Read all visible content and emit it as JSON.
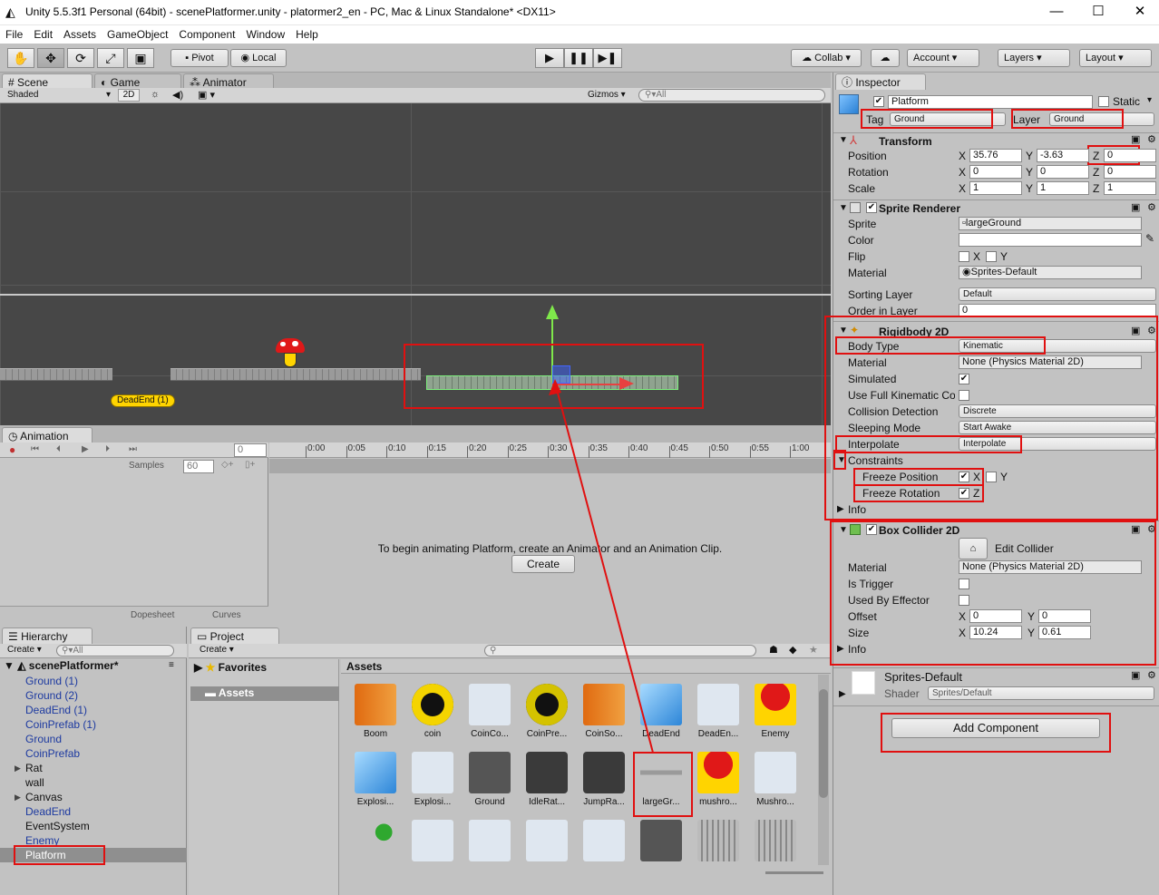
{
  "window": {
    "title": "Unity 5.5.3f1 Personal (64bit) - scenePlatformer.unity - platormer2_en - PC, Mac & Linux Standalone* <DX11>"
  },
  "menu": [
    "File",
    "Edit",
    "Assets",
    "GameObject",
    "Component",
    "Window",
    "Help"
  ],
  "toolbar": {
    "pivot": "Pivot",
    "local": "Local",
    "collab": "Collab",
    "account": "Account",
    "layers": "Layers",
    "layout": "Layout"
  },
  "scene": {
    "tabs": [
      "Scene",
      "Game",
      "Animator"
    ],
    "shading": "Shaded",
    "mode2d": "2D",
    "gizmos": "Gizmos",
    "search_placeholder": "All",
    "deadend_label": "DeadEnd (1)"
  },
  "animation": {
    "tab": "Animation",
    "frame": "0",
    "samples_label": "Samples",
    "samples": "60",
    "ticks": [
      "0:00",
      "0:05",
      "0:10",
      "0:15",
      "0:20",
      "0:25",
      "0:30",
      "0:35",
      "0:40",
      "0:45",
      "0:50",
      "0:55",
      "1:00"
    ],
    "message": "To begin animating Platform, create an Animator and an Animation Clip.",
    "create": "Create",
    "dopesheet": "Dopesheet",
    "curves": "Curves"
  },
  "hierarchy": {
    "tab": "Hierarchy",
    "create": "Create",
    "search_placeholder": "All",
    "scene": "scenePlatformer*",
    "items": [
      {
        "label": "Ground (1)",
        "color": "#1d3aa0",
        "arrow": ""
      },
      {
        "label": "Ground (2)",
        "color": "#1d3aa0",
        "arrow": ""
      },
      {
        "label": "DeadEnd (1)",
        "color": "#1d3aa0",
        "arrow": ""
      },
      {
        "label": "CoinPrefab (1)",
        "color": "#1d3aa0",
        "arrow": ""
      },
      {
        "label": "Ground",
        "color": "#1d3aa0",
        "arrow": ""
      },
      {
        "label": "CoinPrefab",
        "color": "#1d3aa0",
        "arrow": ""
      },
      {
        "label": "Rat",
        "color": "#111111",
        "arrow": "▶"
      },
      {
        "label": "wall",
        "color": "#111111",
        "arrow": ""
      },
      {
        "label": "Canvas",
        "color": "#111111",
        "arrow": "▶"
      },
      {
        "label": "DeadEnd",
        "color": "#1d3aa0",
        "arrow": ""
      },
      {
        "label": "EventSystem",
        "color": "#111111",
        "arrow": ""
      },
      {
        "label": "Enemy",
        "color": "#1d3aa0",
        "arrow": ""
      },
      {
        "label": "Platform",
        "color": "#1d3aa0",
        "arrow": ""
      }
    ]
  },
  "project": {
    "tab": "Project",
    "create": "Create",
    "favorites": "Favorites",
    "assets_folder": "Assets",
    "assets_header": "Assets",
    "assets_row1": [
      "Boom",
      "coin",
      "CoinCo...",
      "CoinPre...",
      "CoinSo...",
      "DeadEnd",
      "DeadEn...",
      "Enemy"
    ],
    "assets_row2": [
      "Explosi...",
      "Explosi...",
      "Ground",
      "IdleRat...",
      "JumpRa...",
      "largeGr...",
      "mushro...",
      "Mushro..."
    ]
  },
  "inspector": {
    "tab": "Inspector",
    "object_name": "Platform",
    "static": "Static",
    "tag_label": "Tag",
    "tag": "Ground",
    "layer_label": "Layer",
    "layer": "Ground",
    "transform": {
      "title": "Transform",
      "position_label": "Position",
      "rotation_label": "Rotation",
      "scale_label": "Scale",
      "pos": [
        "35.76",
        "-3.63",
        "0"
      ],
      "rot": [
        "0",
        "0",
        "0"
      ],
      "scale": [
        "1",
        "1",
        "1"
      ]
    },
    "sprite_renderer": {
      "title": "Sprite Renderer",
      "sprite_label": "Sprite",
      "sprite": "largeGround",
      "color_label": "Color",
      "flip_label": "Flip",
      "material_label": "Material",
      "material": "Sprites-Default",
      "sorting_label": "Sorting Layer",
      "sorting": "Default",
      "order_label": "Order in Layer",
      "order": "0"
    },
    "rigidbody": {
      "title": "Rigidbody 2D",
      "body_type_label": "Body Type",
      "body_type": "Kinematic",
      "material_label": "Material",
      "material": "None (Physics Material 2D)",
      "simulated_label": "Simulated",
      "full_kinematic_label": "Use Full Kinematic Co",
      "collision_label": "Collision Detection",
      "collision": "Discrete",
      "sleeping_label": "Sleeping Mode",
      "sleeping": "Start Awake",
      "interpolate_label": "Interpolate",
      "interpolate": "Interpolate",
      "constraints_label": "Constraints",
      "freeze_pos_label": "Freeze Position",
      "freeze_rot_label": "Freeze Rotation",
      "info_label": "Info"
    },
    "box_collider": {
      "title": "Box Collider 2D",
      "edit_label": "Edit Collider",
      "material_label": "Material",
      "material": "None (Physics Material 2D)",
      "trigger_label": "Is Trigger",
      "effector_label": "Used By Effector",
      "offset_label": "Offset",
      "offset": [
        "0",
        "0"
      ],
      "size_label": "Size",
      "size": [
        "10.24",
        "0.61"
      ],
      "info_label": "Info"
    },
    "material_block": {
      "name": "Sprites-Default",
      "shader_label": "Shader",
      "shader": "Sprites/Default"
    },
    "add_component": "Add Component"
  }
}
